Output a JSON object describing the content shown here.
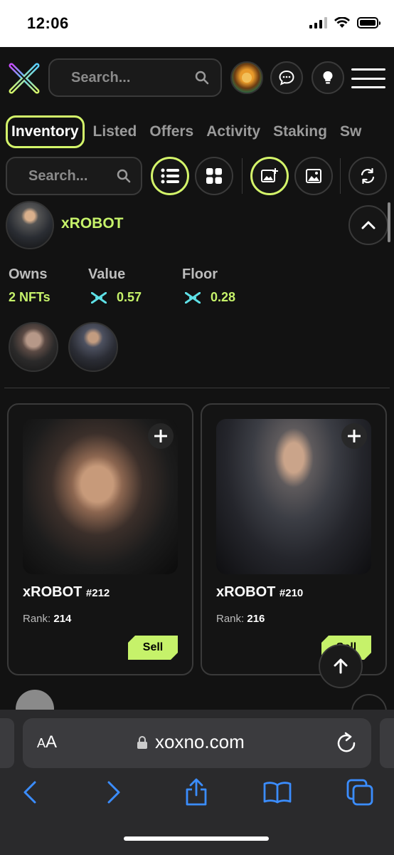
{
  "status_bar": {
    "time": "12:06"
  },
  "header": {
    "search_placeholder": "Search..."
  },
  "tabs": [
    {
      "label": "Inventory",
      "active": true
    },
    {
      "label": "Listed"
    },
    {
      "label": "Offers"
    },
    {
      "label": "Activity"
    },
    {
      "label": "Staking"
    },
    {
      "label": "Sw"
    }
  ],
  "filters": {
    "search_placeholder": "Search..."
  },
  "collection": {
    "name": "xROBOT",
    "stats": {
      "owns_label": "Owns",
      "owns_value": "2 NFTs",
      "value_label": "Value",
      "value_amount": "0.57",
      "floor_label": "Floor",
      "floor_amount": "0.28"
    }
  },
  "nfts": [
    {
      "name": "xROBOT",
      "number": "#212",
      "rank_label": "Rank:",
      "rank": "214",
      "action": "Sell"
    },
    {
      "name": "xROBOT",
      "number": "#210",
      "rank_label": "Rank:",
      "rank": "216",
      "action": "Sell"
    }
  ],
  "browser": {
    "text_size_label_small": "A",
    "text_size_label_large": "A",
    "url": "xoxno.com"
  },
  "colors": {
    "accent": "#c6f26a",
    "background": "#121212"
  }
}
